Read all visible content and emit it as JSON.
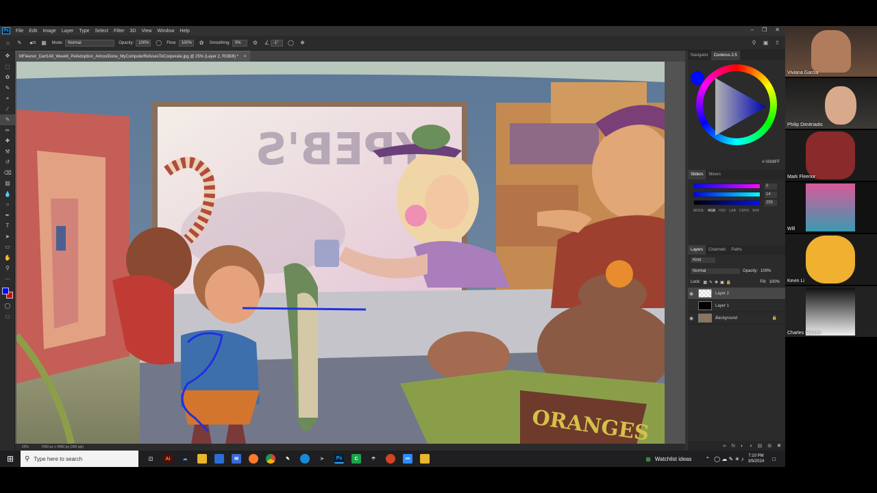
{
  "menu": {
    "logo": "Ps",
    "items": [
      "File",
      "Edit",
      "Image",
      "Layer",
      "Type",
      "Select",
      "Filter",
      "3D",
      "View",
      "Window",
      "Help"
    ]
  },
  "options": {
    "mode_label": "Mode:",
    "mode_value": "Normal",
    "opacity_label": "Opacity:",
    "opacity_value": "100%",
    "flow_label": "Flow:",
    "flow_value": "100%",
    "smoothing_label": "Smoothing:",
    "smoothing_value": "0%",
    "angle_value": "-1°",
    "brush_size": "25"
  },
  "document": {
    "tab_title": "MFleenor_Dart148_Week6_PetAdoption_AlmostDone_MyComputerRefusesToCooperate.jpg @ 25% (Layer 2, RGB/8) *",
    "zoom": "25%",
    "dimensions": "7650 px x 4950 px (300 ppi)"
  },
  "panels": {
    "top_tabs": [
      "Navigator",
      "Coolorus 2.5"
    ],
    "hex_label": "# 0008FF",
    "slider_tabs": [
      "Sliders",
      "Mixers"
    ],
    "slider_values": [
      "0",
      "14",
      "255"
    ],
    "modes_label": "MODE:",
    "modes": [
      "RGB",
      "HSV",
      "LAB",
      "CMYK",
      "B/W"
    ],
    "layer_tabs": [
      "Layers",
      "Channels",
      "Paths"
    ],
    "kind_label": "Kind",
    "blend_mode": "Normal",
    "opacity_label": "Opacity:",
    "opacity_value": "100%",
    "lock_label": "Lock:",
    "fill_label": "Fill:",
    "fill_value": "100%",
    "layers": [
      {
        "name": "Layer 2",
        "visible": true
      },
      {
        "name": "Layer 1",
        "visible": false
      },
      {
        "name": "Background",
        "visible": true
      }
    ]
  },
  "artwork": {
    "sign_text": "YPEB'S",
    "box_text": "ORANGES"
  },
  "participants": [
    "Viviana Garcia",
    "Philip Dimitriadis",
    "Mark Fleenor",
    "Will",
    "Kevin Li",
    "Charles Haiwen"
  ],
  "taskbar": {
    "search_placeholder": "Type here to search",
    "widget_label": "Watchlist ideas",
    "time": "7:10 PM",
    "date": "3/5/2024"
  },
  "colors": {
    "foreground": "#0008FF",
    "background_swatch": "#e00000",
    "ps_accent": "#31a8ff"
  }
}
